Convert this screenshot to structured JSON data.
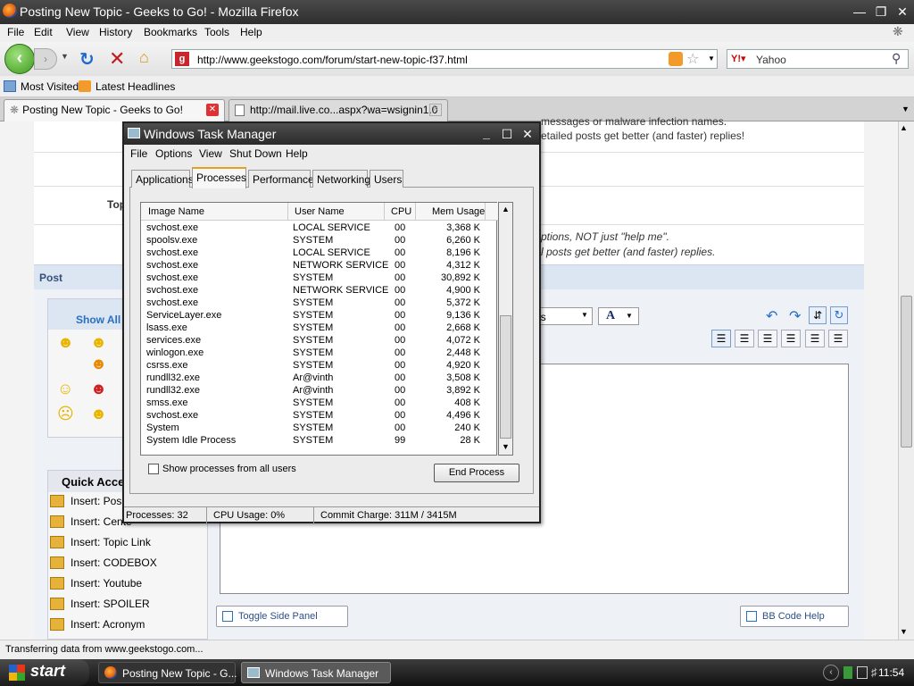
{
  "firefox": {
    "title": "Posting New Topic - Geeks to Go! - Mozilla Firefox",
    "menu": [
      "File",
      "Edit",
      "View",
      "History",
      "Bookmarks",
      "Tools",
      "Help"
    ],
    "url": "http://www.geekstogo.com/forum/start-new-topic-f37.html",
    "search_engine": "Yahoo",
    "bookmarks": [
      "Most Visited",
      "Latest Headlines"
    ],
    "tabs": [
      "Posting New Topic - Geeks to Go!",
      "http://mail.live.co...aspx?wa=wsignin1.0"
    ],
    "status": "Transferring data from www.geekstogo.com..."
  },
  "page": {
    "notice_line1": "messages or malware infection names.",
    "notice_line2": "etailed posts get better (and faster) replies!",
    "topic_label": "Top",
    "hint_line1": "ptions, NOT just \"help me\".",
    "hint_line2": "l posts get better (and faster) replies.",
    "post_header": "Post",
    "show_all": "Show All",
    "quick_access_title": "Quick Acce",
    "quick_access_items": [
      "Insert: Pos",
      "Insert: Cente",
      "Insert: Topic Link",
      "Insert: CODEBOX",
      "Insert: Youtube",
      "Insert: SPOILER",
      "Insert: Acronym"
    ],
    "font_select_fragment": "es",
    "toggle_side_panel": "Toggle Side Panel",
    "bb_code_help": "BB Code Help"
  },
  "taskmgr": {
    "title": "Windows Task Manager",
    "menu": [
      "File",
      "Options",
      "View",
      "Shut Down",
      "Help"
    ],
    "tabs": [
      "Applications",
      "Processes",
      "Performance",
      "Networking",
      "Users"
    ],
    "columns": [
      "Image Name",
      "User Name",
      "CPU",
      "Mem Usage"
    ],
    "processes": [
      [
        "svchost.exe",
        "LOCAL SERVICE",
        "00",
        "3,368 K"
      ],
      [
        "spoolsv.exe",
        "SYSTEM",
        "00",
        "6,260 K"
      ],
      [
        "svchost.exe",
        "LOCAL SERVICE",
        "00",
        "8,196 K"
      ],
      [
        "svchost.exe",
        "NETWORK SERVICE",
        "00",
        "4,312 K"
      ],
      [
        "svchost.exe",
        "SYSTEM",
        "00",
        "30,892 K"
      ],
      [
        "svchost.exe",
        "NETWORK SERVICE",
        "00",
        "4,900 K"
      ],
      [
        "svchost.exe",
        "SYSTEM",
        "00",
        "5,372 K"
      ],
      [
        "ServiceLayer.exe",
        "SYSTEM",
        "00",
        "9,136 K"
      ],
      [
        "lsass.exe",
        "SYSTEM",
        "00",
        "2,668 K"
      ],
      [
        "services.exe",
        "SYSTEM",
        "00",
        "4,072 K"
      ],
      [
        "winlogon.exe",
        "SYSTEM",
        "00",
        "2,448 K"
      ],
      [
        "csrss.exe",
        "SYSTEM",
        "00",
        "4,920 K"
      ],
      [
        "rundll32.exe",
        "Ar@vinth",
        "00",
        "3,508 K"
      ],
      [
        "rundll32.exe",
        "Ar@vinth",
        "00",
        "3,892 K"
      ],
      [
        "smss.exe",
        "SYSTEM",
        "00",
        "408 K"
      ],
      [
        "svchost.exe",
        "SYSTEM",
        "00",
        "4,496 K"
      ],
      [
        "System",
        "SYSTEM",
        "00",
        "240 K"
      ],
      [
        "System Idle Process",
        "SYSTEM",
        "99",
        "28 K"
      ]
    ],
    "show_all_users": "Show processes from all users",
    "end_process": "End Process",
    "status_processes": "Processes: 32",
    "status_cpu": "CPU Usage: 0%",
    "status_commit": "Commit Charge: 311M / 3415M"
  },
  "taskbar": {
    "start": "start",
    "tasks": [
      "Posting New Topic - G...",
      "Windows Task Manager"
    ],
    "clock": "11:54"
  }
}
